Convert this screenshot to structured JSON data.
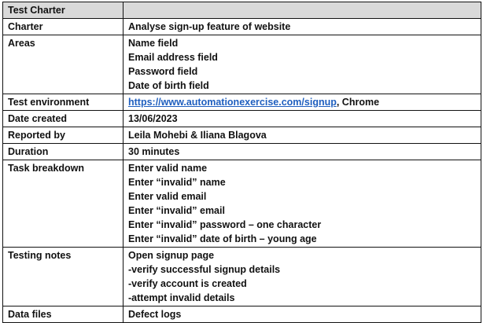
{
  "header": {
    "title": "Test Charter",
    "value": ""
  },
  "charter": {
    "label": "Charter",
    "value": "Analyse sign-up feature of website"
  },
  "areas": {
    "label": "Areas",
    "items": [
      "Name field",
      "Email address field",
      "Password field",
      "Date of birth field"
    ]
  },
  "environment": {
    "label": "Test environment",
    "link": "https://www.automationexercise.com/signup",
    "suffix": ", Chrome",
    "link_color": "#1f5fbf"
  },
  "date_created": {
    "label": "Date created",
    "value": "13/06/2023"
  },
  "reported_by": {
    "label": "Reported by",
    "value": "Leila Mohebi & Iliana Blagova"
  },
  "duration": {
    "label": "Duration",
    "value": "30 minutes"
  },
  "task_breakdown": {
    "label": "Task breakdown",
    "items": [
      "Enter valid name",
      "Enter “invalid” name",
      "Enter valid email",
      "Enter “invalid” email",
      "Enter “invalid” password – one character",
      "Enter “invalid” date of birth – young age"
    ]
  },
  "testing_notes": {
    "label": "Testing notes",
    "items": [
      "Open signup page",
      "-verify successful signup details",
      "-verify account is created",
      "-attempt invalid details"
    ]
  },
  "data_files": {
    "label": "Data files",
    "value": "Defect logs"
  },
  "colors": {
    "header_bg": "#d9d9d9",
    "border": "#111111",
    "text": "#111111"
  }
}
